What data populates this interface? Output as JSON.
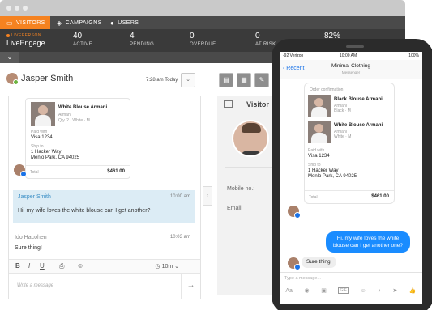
{
  "desktop": {
    "nav": {
      "visitors": "VISITORS",
      "campaigns": "CAMPAIGNS",
      "users": "USERS"
    },
    "brand": {
      "small": "LIVEPERSON",
      "large": "LiveEngage"
    },
    "stats": [
      {
        "num": "40",
        "label": "ACTIVE"
      },
      {
        "num": "4",
        "label": "PENDING"
      },
      {
        "num": "0",
        "label": "OVERDUE"
      },
      {
        "num": "0",
        "label": "AT RISK"
      },
      {
        "num": "82%",
        "label": ""
      }
    ],
    "agent_name": "Jasper Smith",
    "chat_time": "7:28 am  Today",
    "order": {
      "product": "White Blouse Armani",
      "brand": "Armani",
      "detail": "Qty. 2 · White · M",
      "paid_label": "Paid with",
      "paid_value": "Visa 1234",
      "ship_label": "Ship to",
      "ship_line1": "1 Hacker Way",
      "ship_line2": "Menlo Park, CA 94025",
      "total_label": "Total",
      "total_value": "$461.00"
    },
    "customer_msg": {
      "who": "Jasper Smith",
      "time": "10:00 am",
      "text": "Hi, my wife loves the white blouse can I get another?"
    },
    "agent_msg": {
      "who": "Ido Hacohen",
      "time": "10:03 am",
      "text": "Sure thing!"
    },
    "toolbar": {
      "bold": "B",
      "italic": "I",
      "underline": "U",
      "timer": "10m"
    },
    "compose_placeholder": "Write a message",
    "visitor": {
      "title": "Visitor in",
      "mobile_label": "Mobile no.:",
      "email_label": "Email:"
    }
  },
  "phone": {
    "status": {
      "carrier": "-92 Verizon",
      "time": "10:00 AM",
      "battery": "100%"
    },
    "back": "Recent",
    "title": "Minimal Clothing",
    "subtitle": "Messenger",
    "order": {
      "header": "Order confirmation",
      "item1_title": "Black Blouse Armani",
      "item1_brand": "Armani",
      "item1_detail": "Black · M",
      "item2_title": "White Blouse Armani",
      "item2_brand": "Armani",
      "item2_detail": "White · M",
      "paid_label": "Paid with",
      "paid_value": "Visa 1234",
      "ship_label": "Ship to",
      "ship_line1": "1 Hacker Way",
      "ship_line2": "Menlo Park, CA 94025",
      "total_label": "Total",
      "total_value": "$461.00"
    },
    "out_msg": "Hi, my wife loves the white blouse can I get another one?",
    "in_msg": "Sure thing!",
    "compose_placeholder": "Type a message...",
    "input_icons": {
      "aa": "Aa",
      "camera": "◉",
      "photo": "▣",
      "gif": "GIF",
      "emoji": "☺",
      "mic": "♪",
      "location": "➤",
      "like": "👍"
    }
  },
  "colors": {
    "accent": "#f58220",
    "messenger_blue": "#1a8cff",
    "customer_bg": "#dcecf5"
  }
}
